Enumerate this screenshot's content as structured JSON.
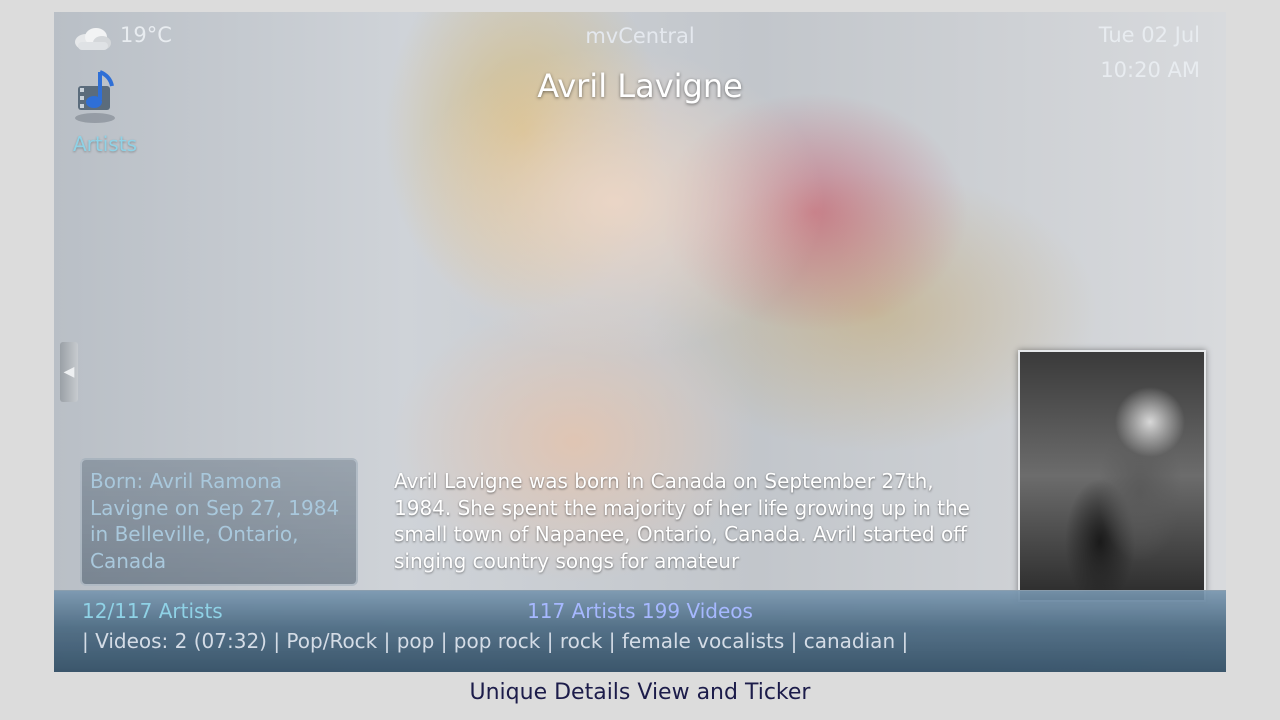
{
  "header": {
    "weather_icon": "cloud-icon",
    "temperature": "19°C",
    "app_name": "mvCentral",
    "date": "Tue 02 Jul",
    "time": "10:20 AM"
  },
  "section": {
    "icon": "music-note-film-icon",
    "label": "Artists"
  },
  "artist": {
    "name": "Avril Lavigne",
    "born": "Born: Avril Ramona Lavigne on Sep 27, 1984 in Belleville, Ontario, Canada",
    "bio": "Avril Lavigne was born in Canada on September 27th, 1984. She spent the majority of her life growing up in the small town of Napanee, Ontario, Canada. Avril started off singing country songs for amateur"
  },
  "footer": {
    "position": "12/117 Artists",
    "totals": "117 Artists 199 Videos",
    "ticker": "| Videos: 2 (07:32) | Pop/Rock | pop | pop rock | rock | female vocalists | canadian  |"
  },
  "caption": "Unique Details View and Ticker",
  "colors": {
    "accent_cyan": "#8fd2e6",
    "accent_blue": "#a6b8ff",
    "caption_text": "#1c1c4a"
  }
}
